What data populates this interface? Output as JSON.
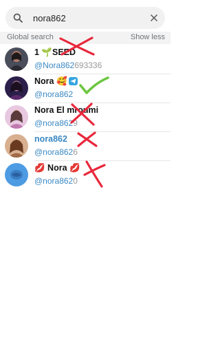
{
  "search": {
    "value": "nora862",
    "placeholder": ""
  },
  "section": {
    "title": "Global search",
    "show_less": "Show less"
  },
  "results": [
    {
      "name": "1 🌱SEED",
      "handle_match": "@Nora862",
      "handle_rest": "693336",
      "verdict": "rejected"
    },
    {
      "name": "Nora 🥰",
      "handle_match": "@nora862",
      "handle_rest": "",
      "verdict": "approved"
    },
    {
      "name": "Nora El mroumi",
      "handle_match": "@nora862",
      "handle_rest": "9",
      "verdict": "rejected"
    },
    {
      "name": "nora862",
      "handle_match": "@nora862",
      "handle_rest": "6",
      "verdict": "rejected"
    },
    {
      "name": "💋 Nora 💋",
      "handle_match": "@nora862",
      "handle_rest": "0",
      "verdict": "rejected"
    }
  ],
  "colors": {
    "link": "#3a88c4",
    "check_mark": "#6cc640",
    "cross_mark": "#e8283c",
    "telegram_badge": "#35a6e0"
  }
}
